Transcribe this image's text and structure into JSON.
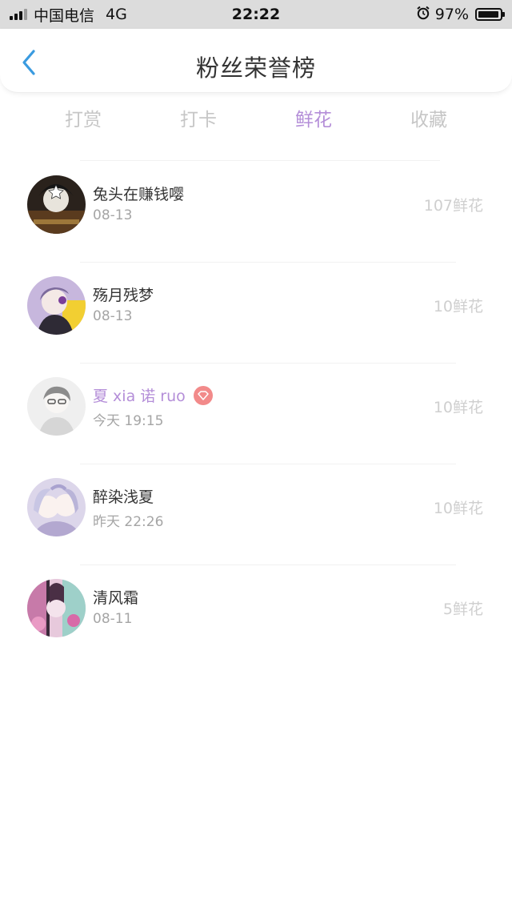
{
  "status_bar": {
    "carrier": "中国电信",
    "network": "4G",
    "time": "22:22",
    "battery": "97%",
    "battery_level": 0.97
  },
  "header": {
    "title": "粉丝荣誉榜",
    "back_icon": "chevron-left-icon"
  },
  "tabs": [
    {
      "label": "打赏",
      "active": false
    },
    {
      "label": "打卡",
      "active": false
    },
    {
      "label": "鲜花",
      "active": true
    },
    {
      "label": "收藏",
      "active": false
    }
  ],
  "fans": [
    {
      "name": "兔头在赚钱嘤",
      "date": "08-13",
      "amount": "107鲜花",
      "vip": false
    },
    {
      "name": "殇月残梦",
      "date": "08-13",
      "amount": "10鲜花",
      "vip": false
    },
    {
      "name": "夏 xia 诺 ruo",
      "date": "今天 19:15",
      "amount": "10鲜花",
      "vip": true
    },
    {
      "name": "醉染浅夏",
      "date": "昨天 22:26",
      "amount": "10鲜花",
      "vip": false
    },
    {
      "name": "清风霜",
      "date": "08-11",
      "amount": "5鲜花",
      "vip": false
    }
  ],
  "colors": {
    "accent": "#b48ed8",
    "inactive_tab": "#c6c6c6",
    "vip_badge": "#f28a8a",
    "back_arrow": "#3a9be0"
  }
}
